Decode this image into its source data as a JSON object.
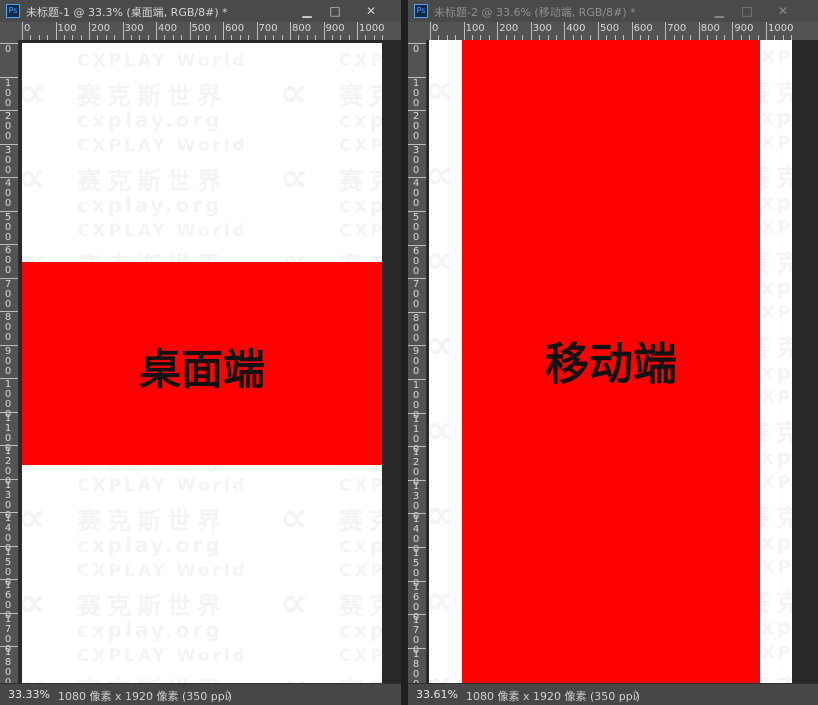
{
  "windows": [
    {
      "title": "未标题-1 @ 33.3% (桌面端, RGB/8#) *",
      "active": true,
      "controls": {
        "minimize": "▁",
        "maximize": "□",
        "close": "✕"
      },
      "ruler_labels": [
        "0",
        "100",
        "200",
        "300",
        "400",
        "500",
        "600",
        "700",
        "800",
        "900",
        "1000"
      ],
      "vruler_digits": [
        "0",
        "1\n0\n0",
        "2\n0\n0",
        "3\n0\n0",
        "4\n0\n0",
        "5\n0\n0",
        "6\n0\n0",
        "7\n0\n0",
        "8\n0\n0",
        "9\n0\n0",
        "1\n0\n0\n0",
        "1\n1\n0\n0",
        "1\n2\n0\n0",
        "1\n3\n0\n0",
        "1\n4\n0\n0",
        "1\n5\n0\n0",
        "1\n6\n0\n0",
        "1\n7\n0\n0",
        "1\n8\n0\n0"
      ],
      "canvas_label": "桌面端",
      "zoom": "33.33%",
      "doc_info": "1080 像素 x 1920 像素 (350 ppi)",
      "status_arrow": "〉"
    },
    {
      "title": "未标题-2 @ 33.6% (移动端, RGB/8#) *",
      "active": false,
      "controls": {
        "minimize": "▁",
        "maximize": "□",
        "close": "✕"
      },
      "ruler_labels": [
        "0",
        "100",
        "200",
        "300",
        "400",
        "500",
        "600",
        "700",
        "800",
        "900",
        "1000"
      ],
      "canvas_label": "移动端",
      "zoom": "33.61%",
      "doc_info": "1080 像素 x 1920 像素 (350 ppi)",
      "status_arrow": "〉"
    }
  ],
  "watermark": {
    "line1": "CXPLAY World",
    "line2": "赛克斯世界",
    "line3": "cxplay.org",
    "logo": "∝"
  },
  "colors": {
    "band": "#ff0000",
    "canvas": "#ffffff",
    "chrome": "#454545",
    "ruler": "#535353"
  }
}
